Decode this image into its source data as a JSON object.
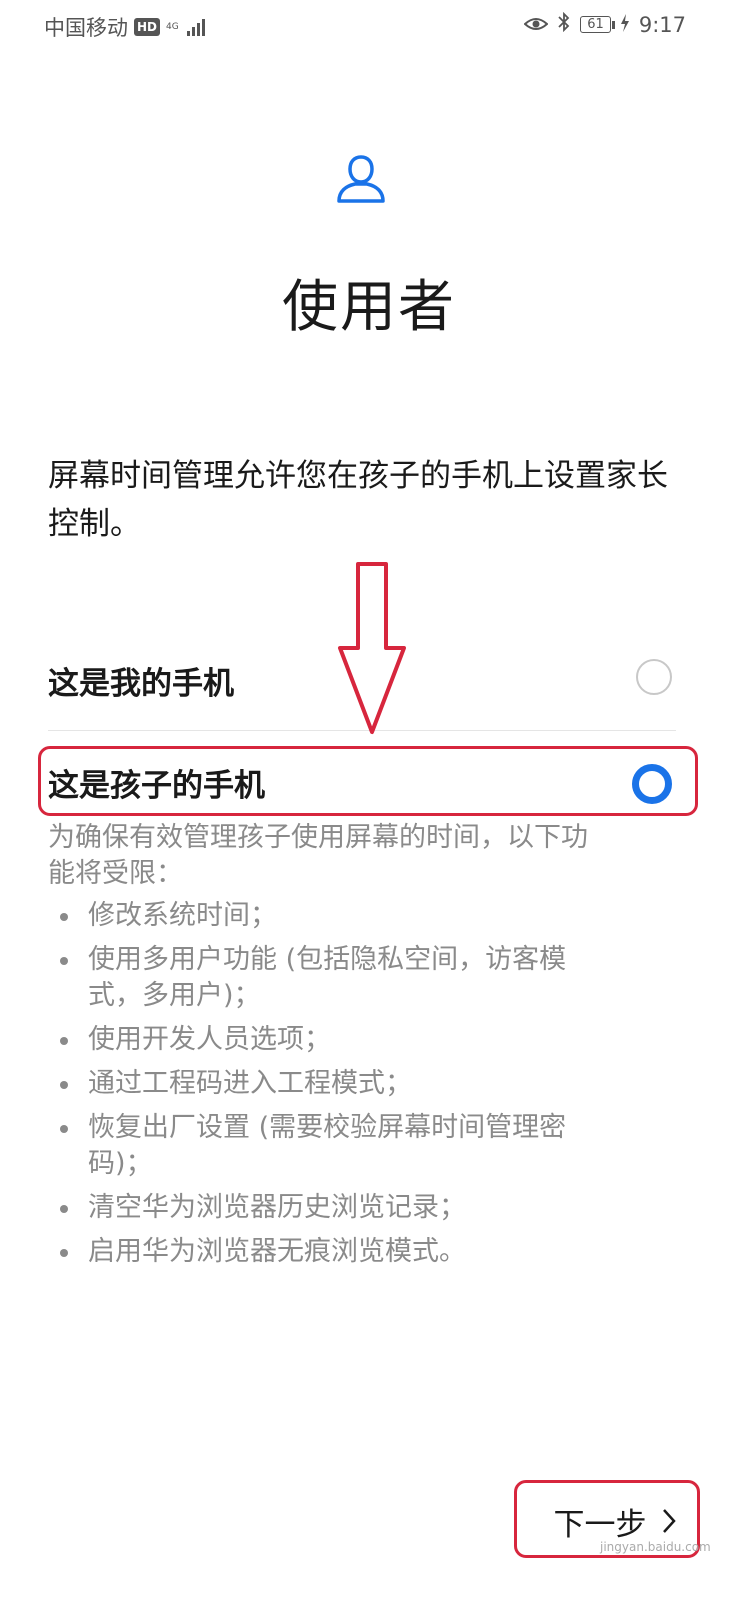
{
  "status_bar": {
    "carrier": "中国移动",
    "hd_badge": "HD",
    "network_type": "4G",
    "battery_level": "61",
    "time": "9:17"
  },
  "header": {
    "icon": "person-icon",
    "title": "使用者"
  },
  "description": "屏幕时间管理允许您在孩子的手机上设置家长控制。",
  "options": [
    {
      "label": "这是我的手机",
      "selected": false
    },
    {
      "label": "这是孩子的手机",
      "selected": true
    }
  ],
  "restrictions": {
    "intro": "为确保有效管理孩子使用屏幕的时间，以下功能将受限：",
    "items": [
      "修改系统时间；",
      "使用多用户功能 (包括隐私空间，访客模式，多用户)；",
      "使用开发人员选项；",
      "通过工程码进入工程模式；",
      "恢复出厂设置 (需要校验屏幕时间管理密码)；",
      "清空华为浏览器历史浏览记录；",
      "启用华为浏览器无痕浏览模式。"
    ]
  },
  "footer": {
    "next_label": "下一步"
  },
  "watermark": "jingyan.baidu.com",
  "colors": {
    "accent": "#1a73e8",
    "annotation": "#d7263d",
    "secondary_text": "#8a8a8a"
  }
}
